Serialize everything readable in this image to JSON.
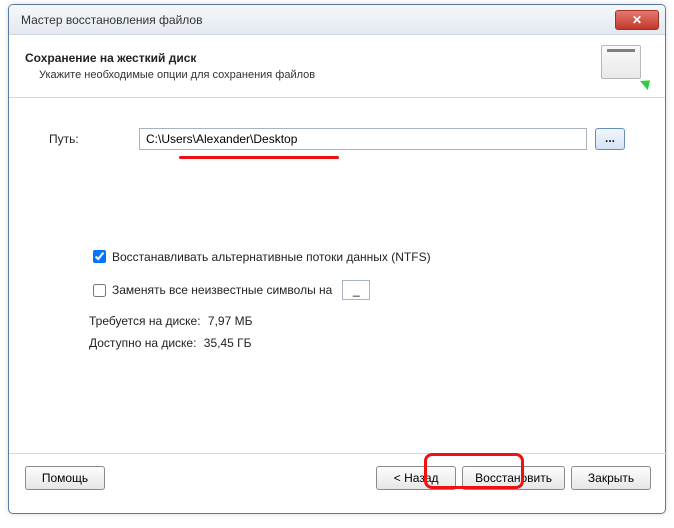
{
  "title": "Мастер восстановления файлов",
  "header": {
    "title": "Сохранение на жесткий диск",
    "subtitle": "Укажите необходимые опции для сохранения файлов"
  },
  "path": {
    "label": "Путь:",
    "value": "C:\\Users\\Alexander\\Desktop",
    "browse": "..."
  },
  "options": {
    "restore_streams_label": "Восстанавливать альтернативные потоки данных (NTFS)",
    "replace_unknown_label": "Заменять все неизвестные символы на",
    "replace_char": "_"
  },
  "disk": {
    "required_label": "Требуется на диске:",
    "required_value": "7,97 МБ",
    "available_label": "Доступно на диске:",
    "available_value": "35,45 ГБ"
  },
  "buttons": {
    "help": "Помощь",
    "back": "< Назад",
    "recover": "Восстановить",
    "close": "Закрыть"
  }
}
